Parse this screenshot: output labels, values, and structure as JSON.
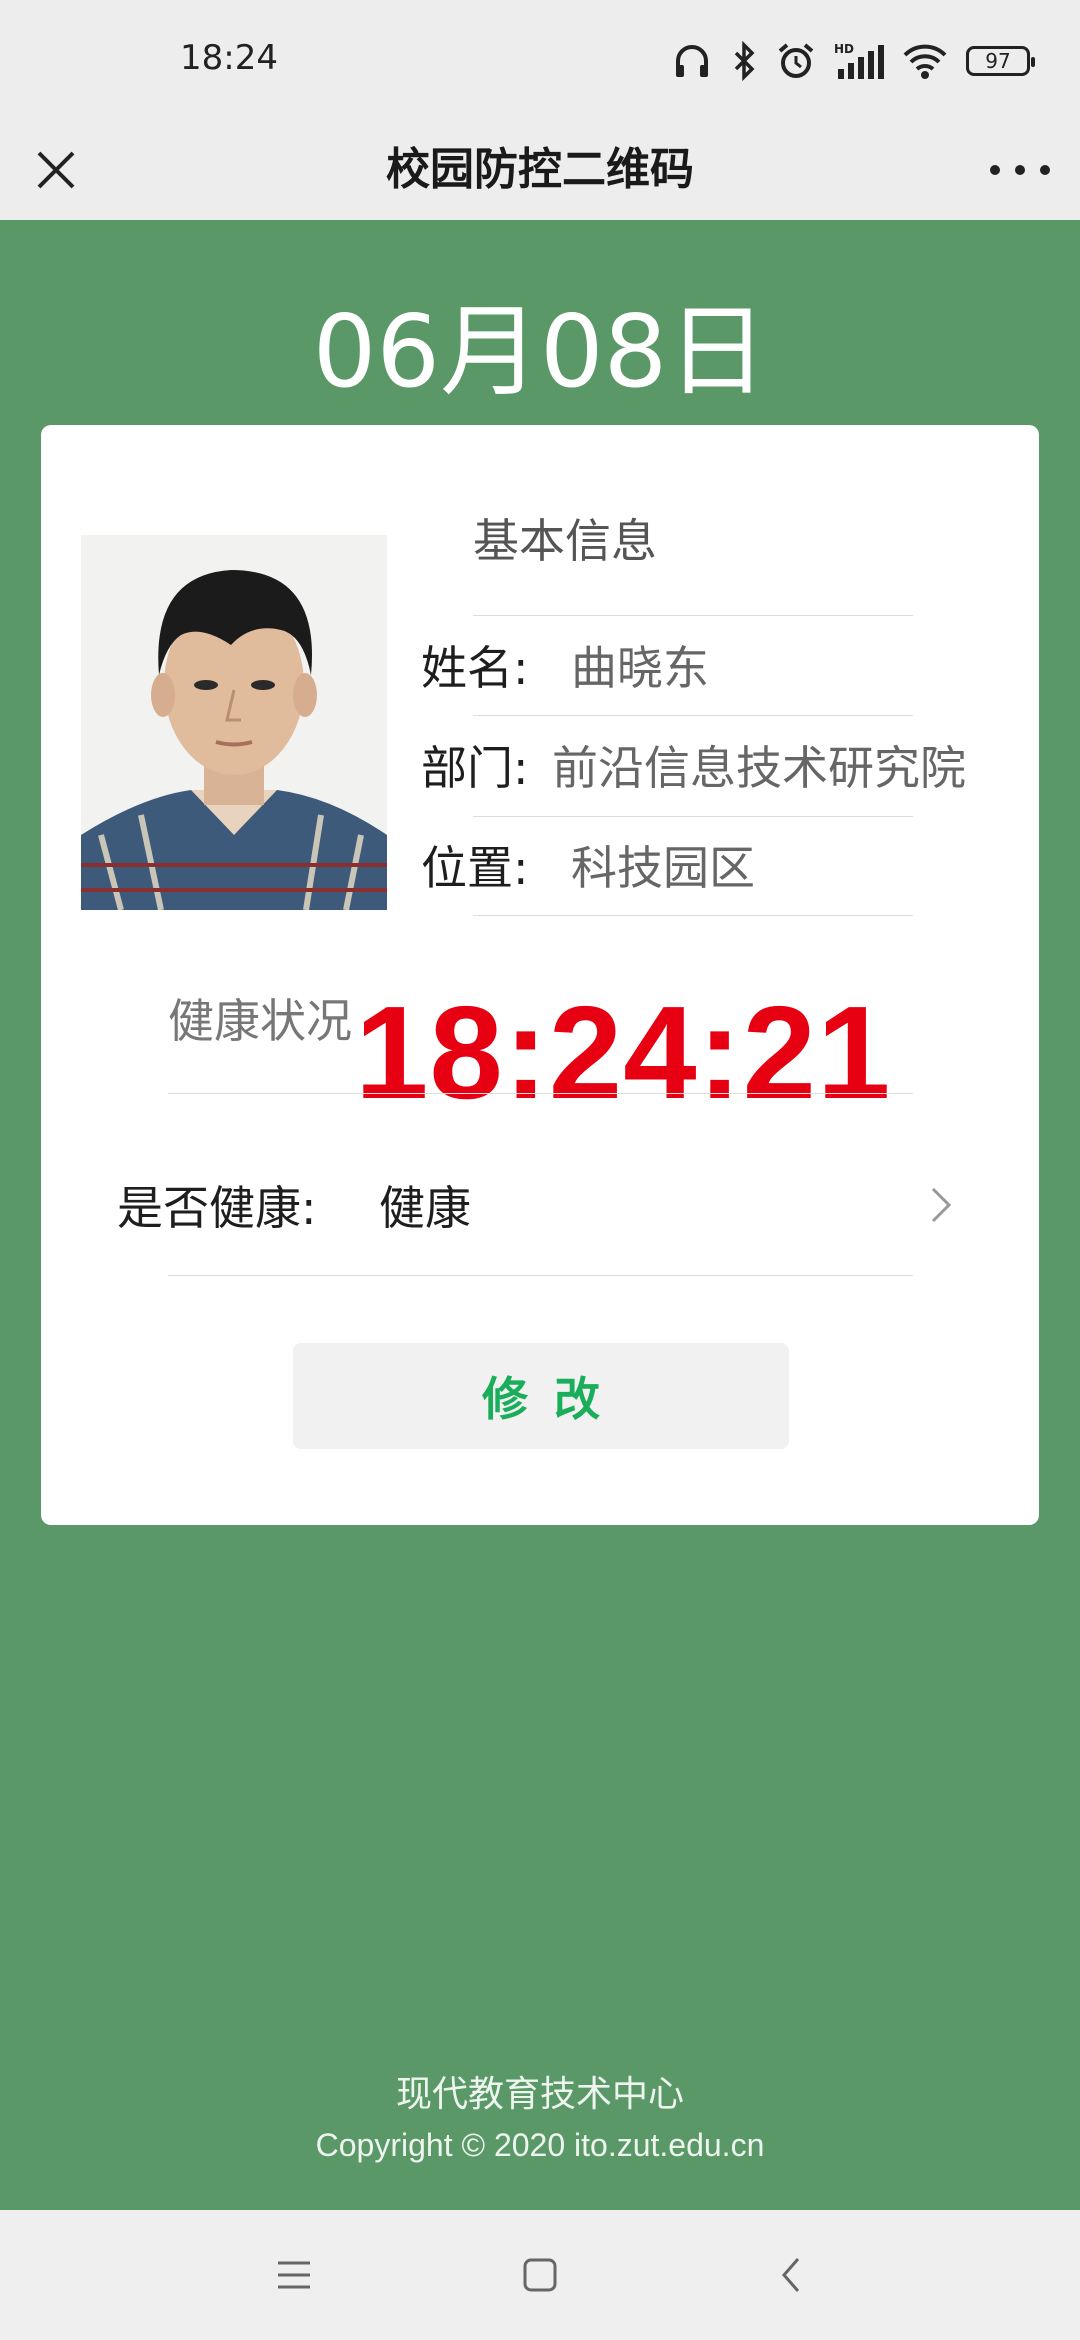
{
  "status_bar": {
    "time": "18:24",
    "battery": "97",
    "icons": [
      "headphones-icon",
      "bluetooth-icon",
      "alarm-icon",
      "hd-signal-icon",
      "wifi-icon",
      "battery-icon"
    ]
  },
  "nav": {
    "title": "校园防控二维码",
    "close_icon": "close-icon",
    "more_icon": "more-icon"
  },
  "date": "06月08日",
  "card": {
    "info_title": "基本信息",
    "fields": [
      {
        "label": "姓名:",
        "value": "曲晓东"
      },
      {
        "label": "部门:",
        "value": "前沿信息技术研究院"
      },
      {
        "label": "位置:",
        "value": "科技园区"
      }
    ],
    "health_title": "健康状况",
    "clock": "18:24:21",
    "healthy_label": "是否健康:",
    "healthy_value": "健康",
    "edit_label": "修改"
  },
  "footer": {
    "org": "现代教育技术中心",
    "copyright": "Copyright © 2020 ito.zut.edu.cn"
  },
  "colors": {
    "background": "#5a9868",
    "clock": "#e60012",
    "edit_text": "#1aad5a"
  }
}
